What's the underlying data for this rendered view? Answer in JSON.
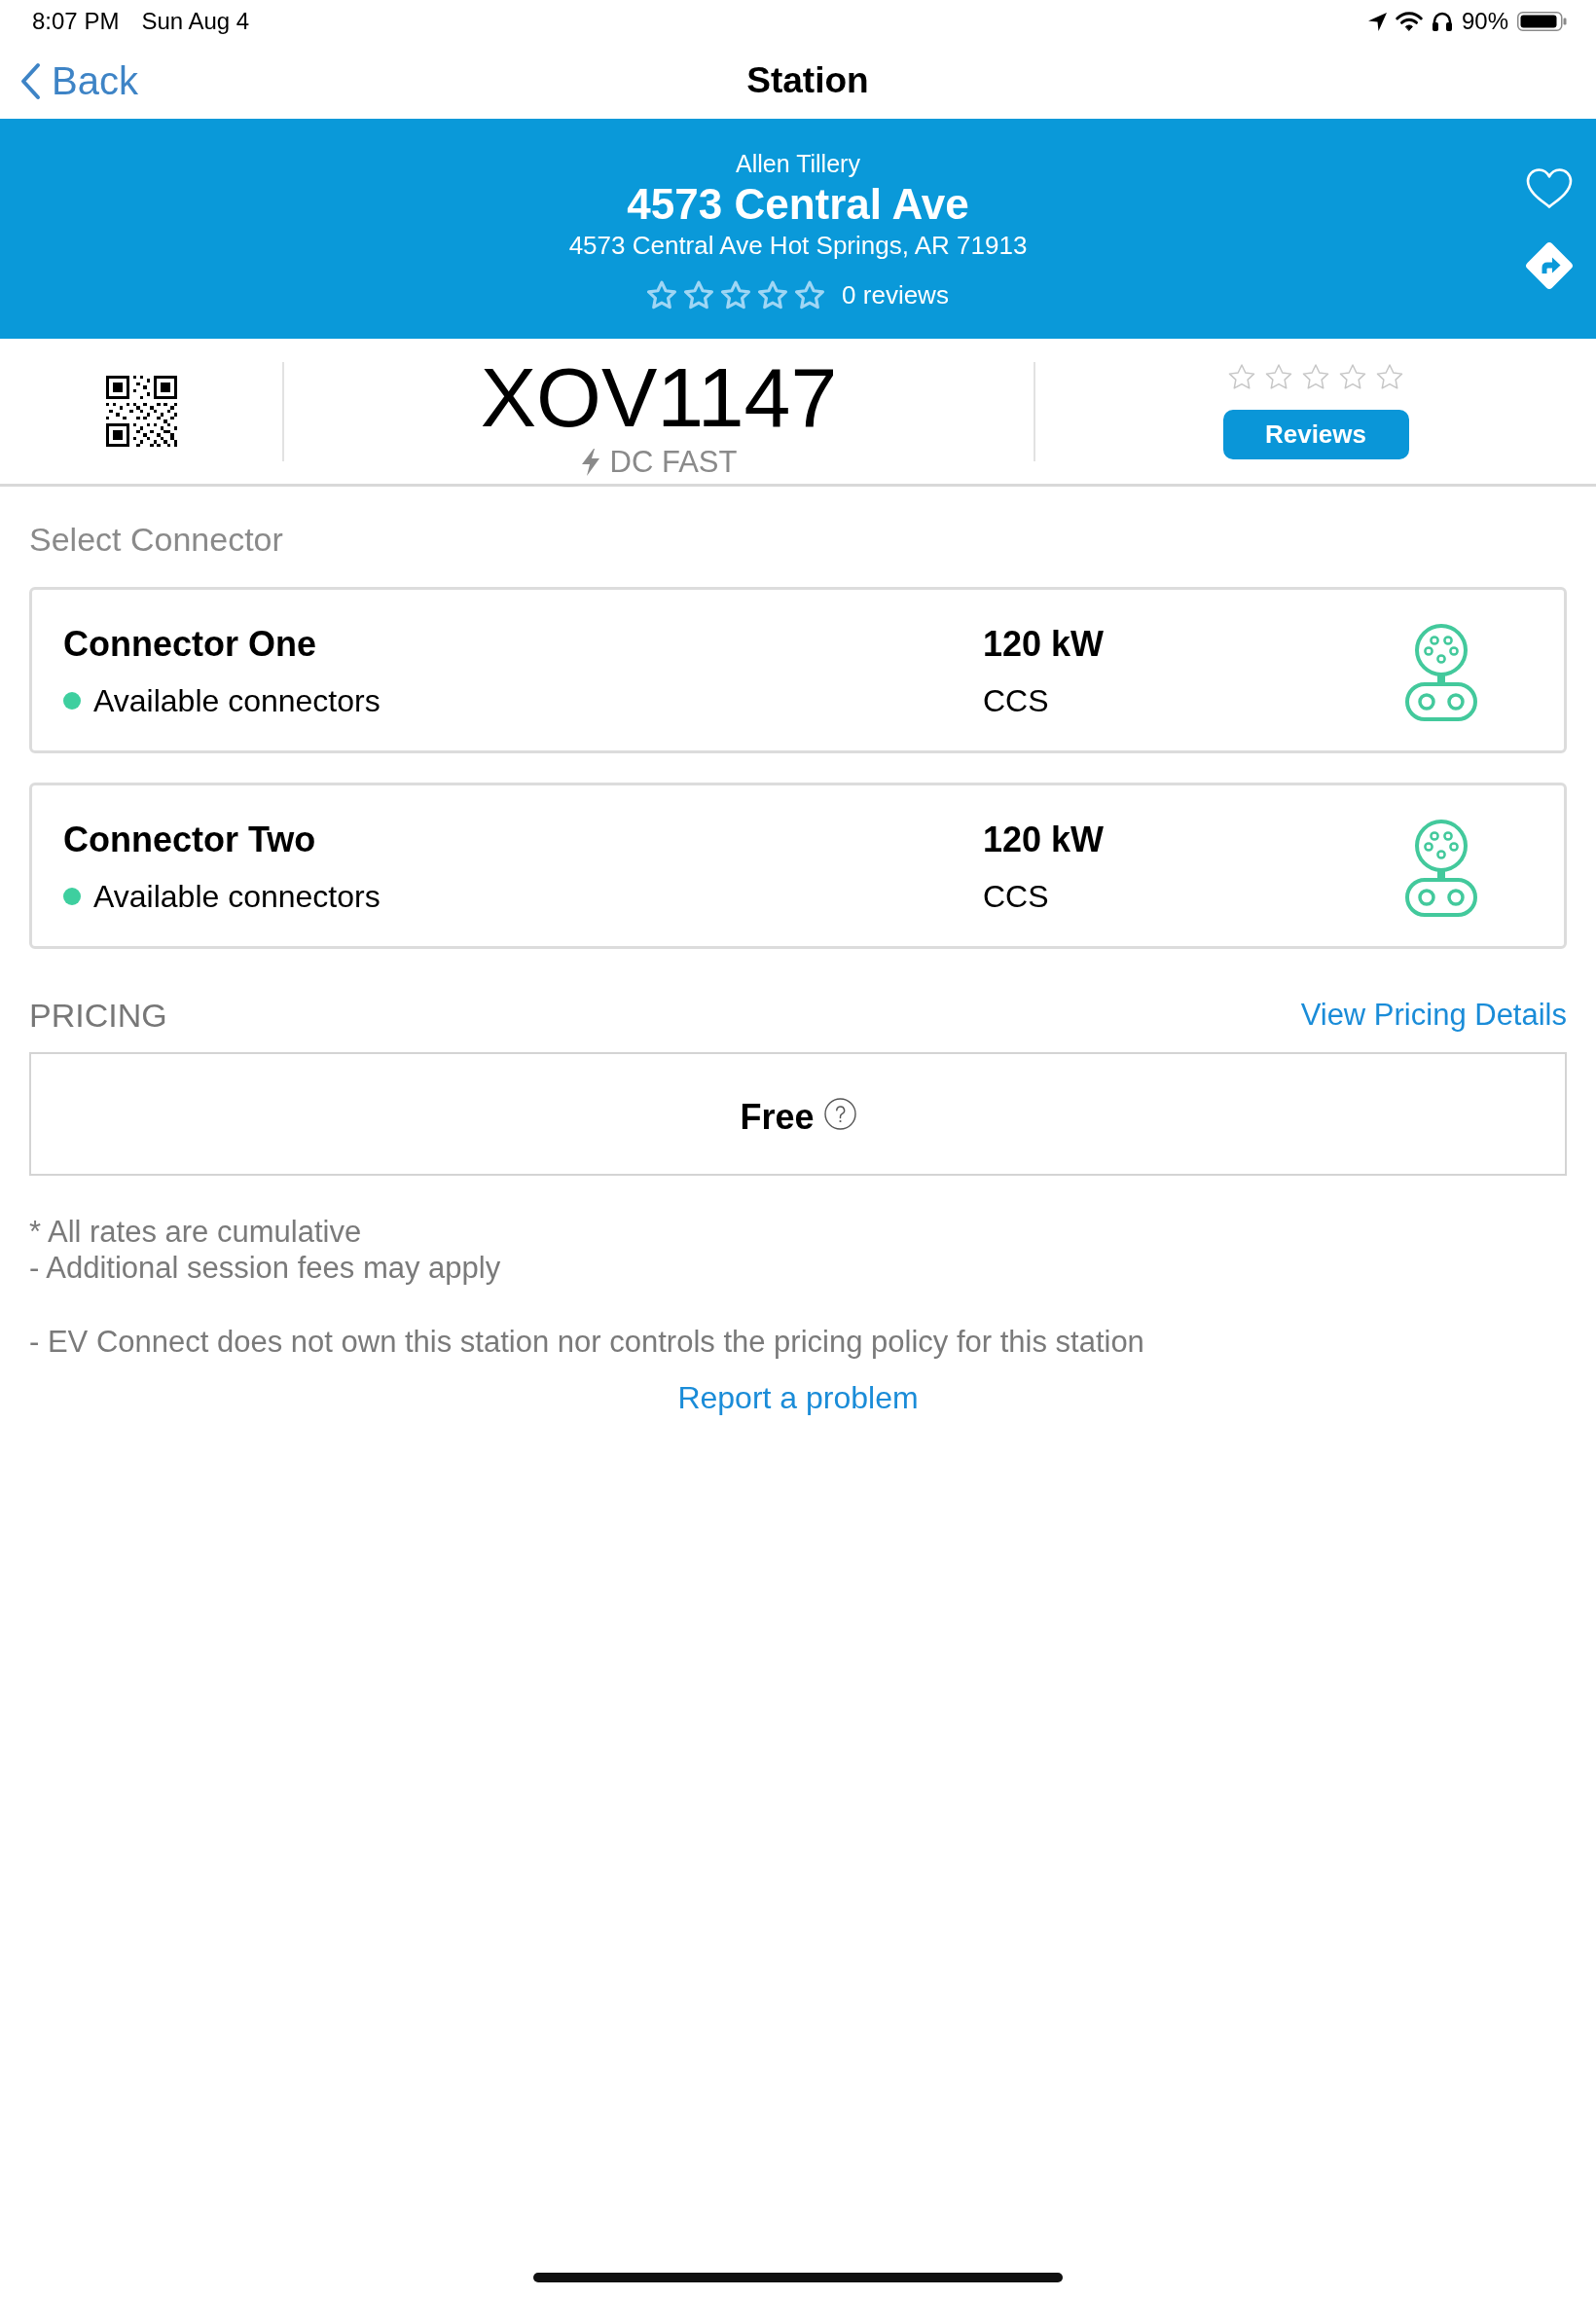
{
  "status_bar": {
    "time": "8:07 PM",
    "date": "Sun Aug 4",
    "battery": "90%"
  },
  "nav": {
    "back": "Back",
    "title": "Station"
  },
  "header": {
    "owner": "Allen Tillery",
    "name": "4573 Central Ave",
    "address": "4573 Central Ave Hot Springs, AR 71913",
    "stars": 0,
    "reviews": "0 reviews",
    "favorite": false
  },
  "station": {
    "id": "XOV1147",
    "speed": "DC FAST",
    "stars": 0,
    "reviews_button": "Reviews"
  },
  "connectors": {
    "title": "Select Connector",
    "items": [
      {
        "name": "Connector One",
        "status": "Available connectors",
        "color": "#3ecf9f",
        "power": "120 kW",
        "type": "CCS"
      },
      {
        "name": "Connector Two",
        "status": "Available connectors",
        "color": "#3ecf9f",
        "power": "120 kW",
        "type": "CCS"
      }
    ]
  },
  "pricing": {
    "title": "PRICING",
    "link": "View Pricing Details",
    "price": "Free"
  },
  "notes": [
    "* All rates are cumulative",
    "- Additional session fees may apply"
  ],
  "disclaimer": "- EV Connect does not own this station nor controls the pricing policy for this station",
  "report_link": "Report a problem"
}
